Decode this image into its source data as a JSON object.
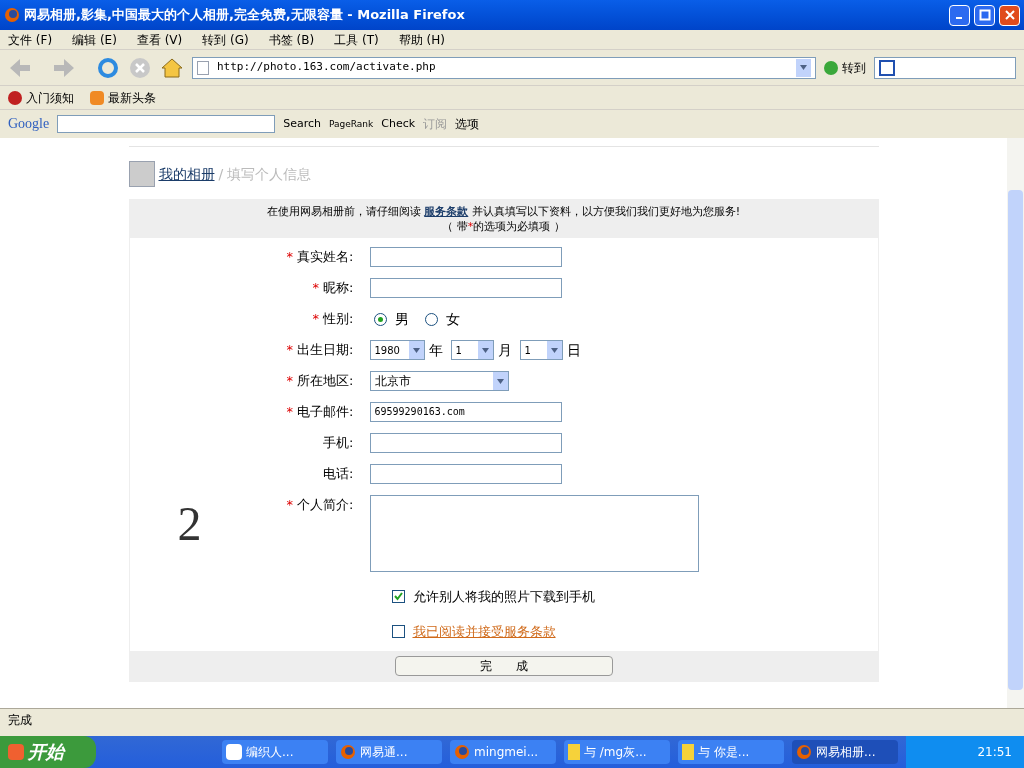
{
  "window": {
    "title": "网易相册,影集,中国最大的个人相册,完全免费,无限容量 - Mozilla Firefox"
  },
  "menu": [
    "文件 (F)",
    "编辑 (E)",
    "查看 (V)",
    "转到 (G)",
    "书签 (B)",
    "工具 (T)",
    "帮助 (H)"
  ],
  "nav": {
    "url": "http://photo.163.com/activate.php",
    "go": "转到"
  },
  "bookmarks": [
    "入门须知",
    "最新头条"
  ],
  "google_bar": {
    "logo": "Google",
    "search": "Search",
    "pagerank": "PageRank",
    "check": "Check",
    "subscribe": "订阅",
    "options": "选项"
  },
  "breadcrumb": {
    "link": "我的相册",
    "separator": "/",
    "current": "填写个人信息"
  },
  "notice": {
    "before": "在使用网易相册前，请仔细阅读",
    "link": "服务条款",
    "after": "并认真填写以下资料，以方便我们我们更好地为您服务!",
    "required_before": "（ 带",
    "required_mark": "*",
    "required_after": "的选项为必填项 ）"
  },
  "form": [
    {
      "kind": "text",
      "label": "真实姓名:",
      "required": true
    },
    {
      "kind": "text",
      "label": "昵称:",
      "required": true
    },
    {
      "kind": "radio",
      "label": "性别:",
      "required": true,
      "options": [
        {
          "label": "男",
          "selected": true
        },
        {
          "label": "女",
          "selected": false
        }
      ]
    },
    {
      "kind": "date",
      "label": "出生日期:",
      "required": true,
      "parts": [
        {
          "value": "1980",
          "unit": "年"
        },
        {
          "value": "1",
          "unit": "月"
        },
        {
          "value": "1",
          "unit": "日"
        }
      ]
    },
    {
      "kind": "select",
      "label": "所在地区:",
      "required": true,
      "value": "北京市"
    },
    {
      "kind": "text",
      "label": "电子邮件:",
      "required": true,
      "value": "69599290163.com"
    },
    {
      "kind": "text",
      "label": "手机:",
      "required": false
    },
    {
      "kind": "text",
      "label": "电话:",
      "required": false
    },
    {
      "kind": "textarea",
      "label": "个人简介:",
      "required": true
    }
  ],
  "checks": [
    {
      "label": "允许别人将我的照片下载到手机",
      "checked": true,
      "link": false
    },
    {
      "label": "我已阅读并接受服务条款",
      "checked": false,
      "link": true
    }
  ],
  "submit": "完　　成",
  "handwritten_mark": "2",
  "status_bar": "完成",
  "taskbar": {
    "start": "开始",
    "tasks": [
      {
        "label": "编织人...",
        "kind": "doc",
        "selected": false
      },
      {
        "label": "网易通...",
        "kind": "firefox",
        "selected": false
      },
      {
        "label": "mingmei...",
        "kind": "firefox",
        "selected": false
      },
      {
        "label": "与 /mg灰...",
        "kind": "chat",
        "selected": false
      },
      {
        "label": "与 你是...",
        "kind": "chat",
        "selected": false
      },
      {
        "label": "网易相册...",
        "kind": "firefox",
        "selected": true
      }
    ],
    "clock": "21:51"
  }
}
